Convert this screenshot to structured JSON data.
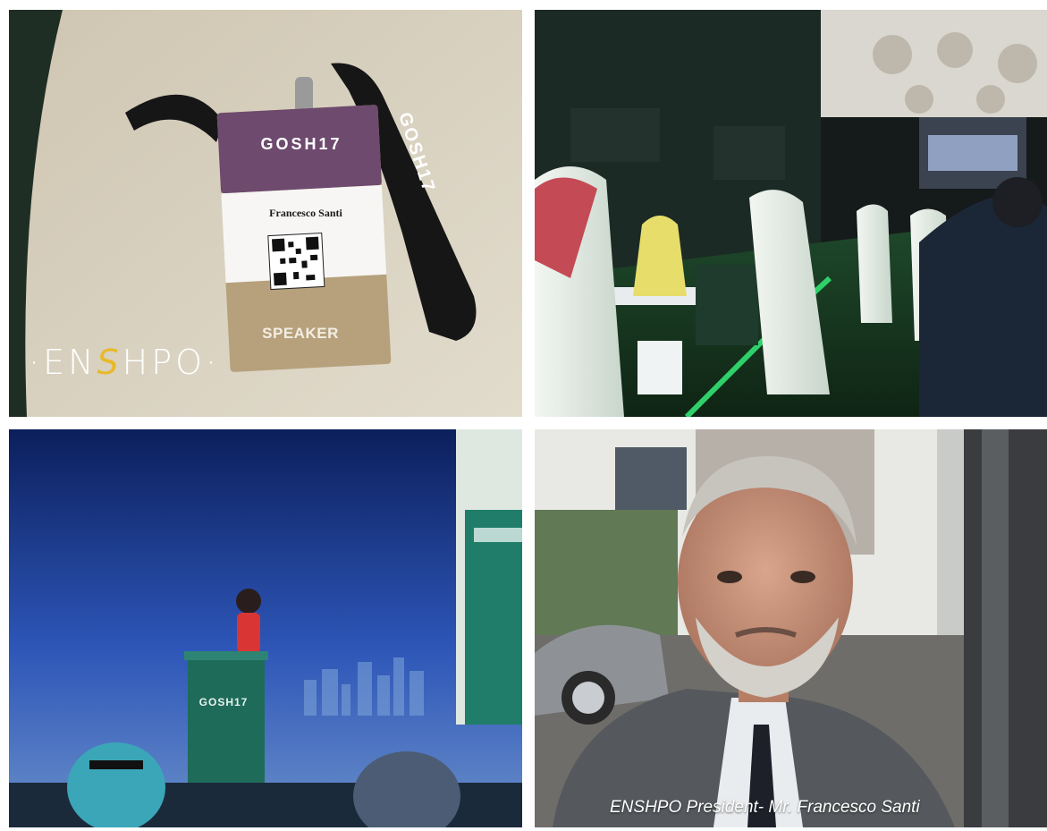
{
  "badge": {
    "logo_text": "GOSH17",
    "name": "Francesco Santi",
    "role": "SPEAKER",
    "lanyard_text": "GOSH17"
  },
  "watermark": {
    "prefix": "·EN",
    "accent": "S",
    "suffix": "HPO·"
  },
  "stage": {
    "podium_logo": "GOSH17"
  },
  "portrait": {
    "caption": "ENSHPO President- Mr. Francesco Santi"
  },
  "colors": {
    "badge_purple": "#6e4a6e",
    "badge_gold": "#a5906e",
    "logo_accent": "#e8b92a",
    "expo_green": "#2fd06a",
    "stage_blue": "#1f3f8f"
  }
}
